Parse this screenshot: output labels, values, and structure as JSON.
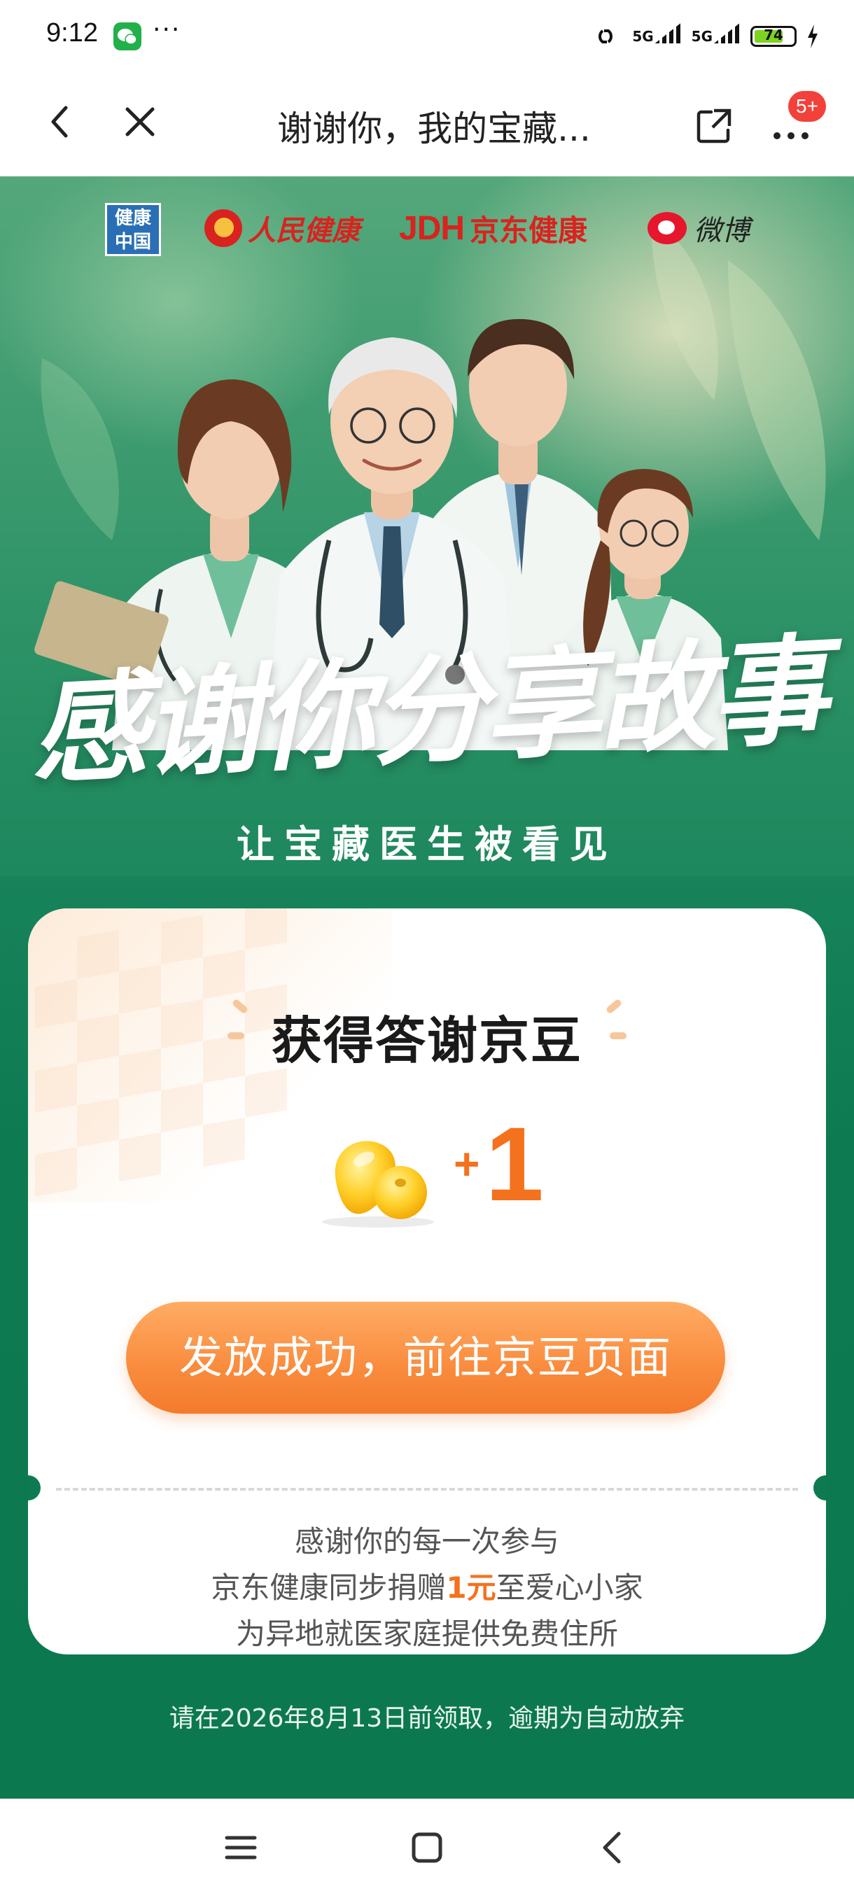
{
  "status_bar": {
    "time": "9:12",
    "more": "···",
    "signal_1": "5G",
    "signal_2": "5G",
    "battery": "74",
    "battery_level_percent": 74,
    "wechat_color": "#22b04b",
    "battery_color": "#7ed321"
  },
  "nav": {
    "title": "谢谢你，我的宝藏...",
    "badge": "5+",
    "icons": [
      "chevron-left-icon",
      "close-icon",
      "share-icon",
      "more-icon"
    ],
    "badge_color": "#f2413a"
  },
  "hero": {
    "logos": {
      "jkzg": "健康中国",
      "rmjk": "人民健康",
      "jdh_mark": "JDH",
      "jdh_text": "京东健康",
      "weibo": "微博"
    },
    "title": "感谢你分享故事",
    "subtitle": "让宝藏医生被看见"
  },
  "card": {
    "title": "获得答谢京豆",
    "reward_plus": "+",
    "reward_value": "1",
    "cta_label": "发放成功，前往京豆页面",
    "thanks_line1": "感谢你的每一次参与",
    "thanks_line2_prefix": "京东健康同步捐赠",
    "thanks_line2_amount": "1元",
    "thanks_line2_suffix": "至爱心小家",
    "thanks_line3": "为异地就医家庭提供免费住所",
    "accent_color": "#f4711e"
  },
  "deadline": "请在2026年8月13日前领取，逾期为自动放弃",
  "system_nav": {
    "icons": [
      "menu-icon",
      "home-icon",
      "back-icon"
    ]
  },
  "colors": {
    "page_green": "#0e7a52",
    "cta_orange": "#f98b3d"
  }
}
